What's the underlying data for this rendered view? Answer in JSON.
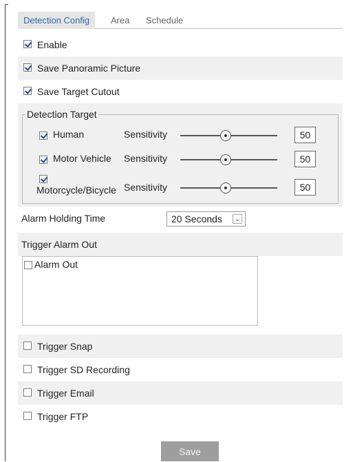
{
  "tabs": [
    {
      "label": "Detection Config"
    },
    {
      "label": "Area"
    },
    {
      "label": "Schedule"
    }
  ],
  "options": {
    "enable": {
      "label": "Enable",
      "checked": true
    },
    "save_panoramic": {
      "label": "Save Panoramic Picture",
      "checked": true
    },
    "save_cutout": {
      "label": "Save Target Cutout",
      "checked": true
    }
  },
  "detection_target": {
    "legend": "Detection Target",
    "sensitivity_label": "Sensitivity",
    "targets": [
      {
        "label": "Human",
        "checked": true,
        "sensitivity": "50"
      },
      {
        "label": "Motor Vehicle",
        "checked": true,
        "sensitivity": "50"
      },
      {
        "label": "Motorcycle/Bicycle",
        "checked": true,
        "sensitivity": "50"
      }
    ]
  },
  "alarm_holding": {
    "label": "Alarm Holding Time",
    "value": "20 Seconds"
  },
  "trigger_alarm_out": {
    "label": "Trigger Alarm Out",
    "items": [
      {
        "label": "Alarm Out",
        "checked": false
      }
    ]
  },
  "triggers": [
    {
      "label": "Trigger Snap",
      "checked": false
    },
    {
      "label": "Trigger SD Recording",
      "checked": false
    },
    {
      "label": "Trigger Email",
      "checked": false
    },
    {
      "label": "Trigger FTP",
      "checked": false
    }
  ],
  "save_button": "Save"
}
